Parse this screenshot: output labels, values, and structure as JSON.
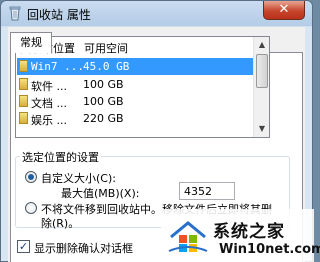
{
  "window": {
    "title": "回收站 属性",
    "close_glyph": "✕"
  },
  "tabs": [
    {
      "label": "常规",
      "active": true
    }
  ],
  "list": {
    "columns": [
      "回收站位置",
      "可用空间"
    ],
    "rows": [
      {
        "name": "Win7 ...",
        "space": "45.0 GB",
        "selected": true
      },
      {
        "name": "软件 ...",
        "space": "100 GB",
        "selected": false
      },
      {
        "name": "文档 ...",
        "space": "100 GB",
        "selected": false
      },
      {
        "name": "娱乐 ...",
        "space": "220 GB",
        "selected": false
      }
    ]
  },
  "settings": {
    "group_title": "选定位置的设置",
    "custom_size_label": "自定义大小(C):",
    "max_value_label": "最大值(MB)(X):",
    "max_value": "4352",
    "no_move_label_line1": "不将文件移到回收站中。移除文件后立即将其删",
    "no_move_label_line2": "除(R)。",
    "custom_size_selected": true
  },
  "confirm_delete": {
    "label": "显示删除确认对话框",
    "checked": true
  },
  "watermark": {
    "text": "系统之家",
    "url": "Win10net.com",
    "logo": "windows-flag-house-logo"
  },
  "colors": {
    "selection": "#3399ff",
    "close_button": "#c7462d"
  }
}
